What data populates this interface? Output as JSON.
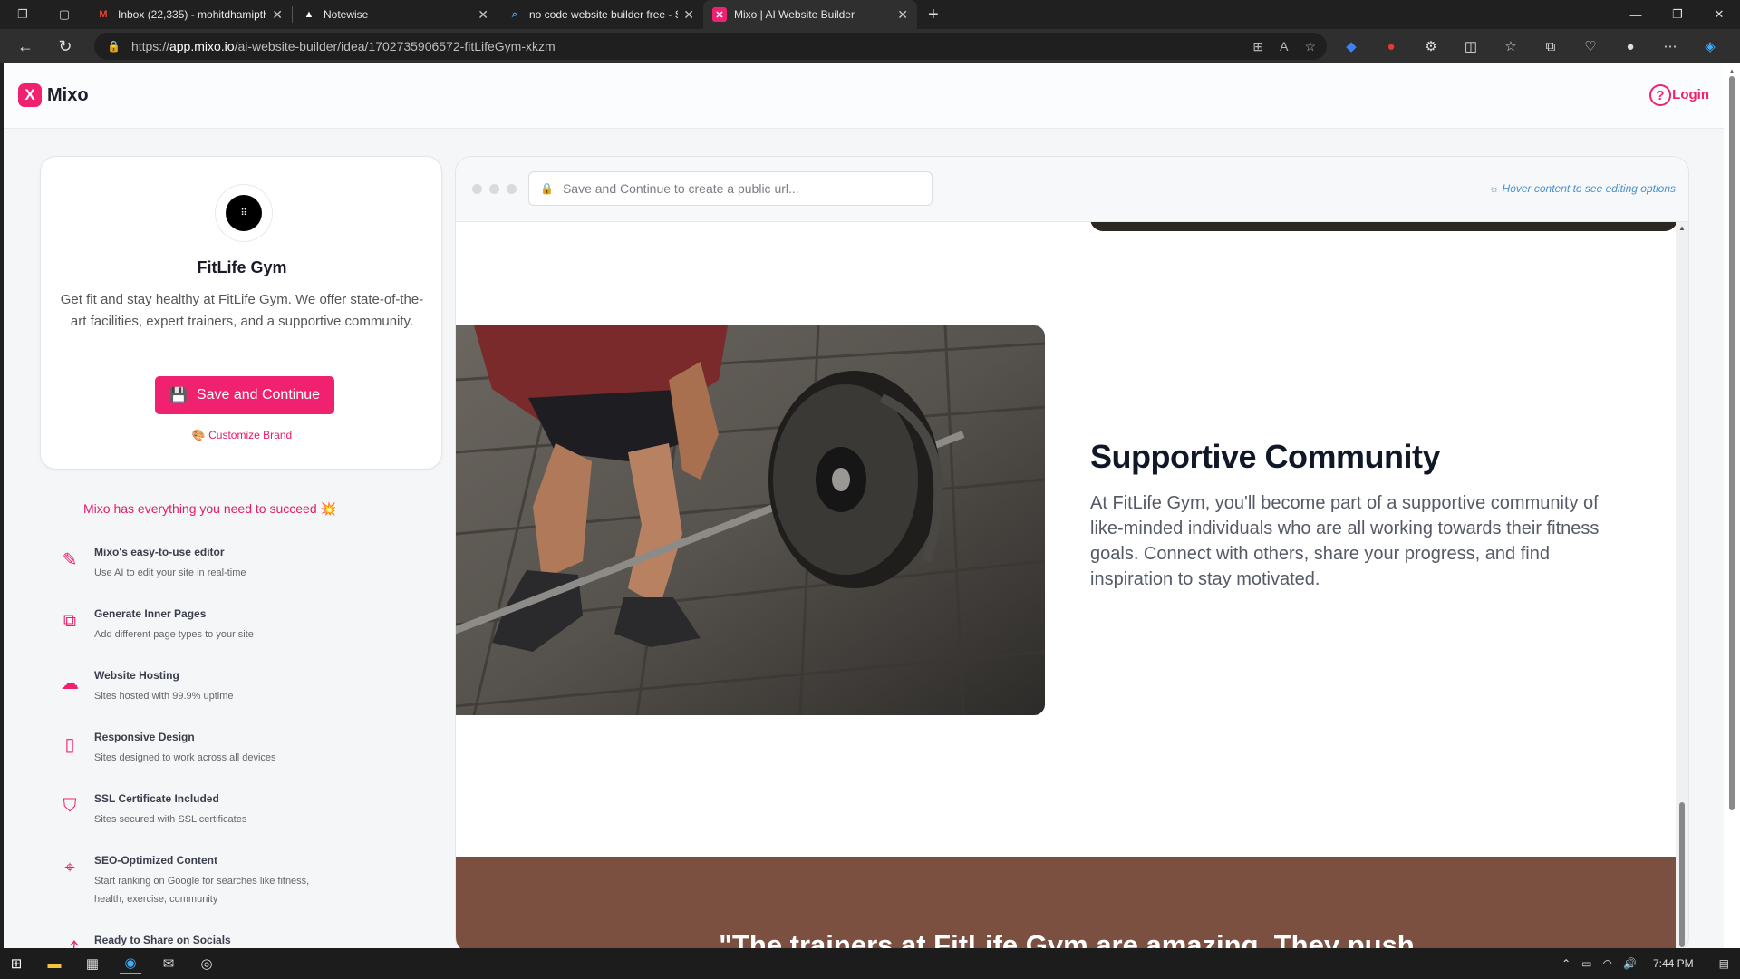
{
  "browser": {
    "tabs": [
      {
        "title": "Inbox (22,335) - mohitdhamipth",
        "icon": "gmail-icon",
        "active": false
      },
      {
        "title": "Notewise",
        "icon": "notewise-icon",
        "active": false
      },
      {
        "title": "no code website builder free - Se",
        "icon": "search-icon",
        "active": false
      },
      {
        "title": "Mixo | AI Website Builder",
        "icon": "mixo-icon",
        "active": true
      }
    ],
    "url_scheme": "https://",
    "url_host": "app.mixo.io",
    "url_path": "/ai-website-builder/idea/1702735906572-fitLifeGym-xkzm"
  },
  "app": {
    "logo_text": "Mixo",
    "logo_mark": "X",
    "login_label": "Login",
    "help_glyph": "?"
  },
  "card": {
    "avatar_glyph": "⠿",
    "business_name": "FitLife Gym",
    "description": "Get fit and stay healthy at FitLife Gym. We offer state-of-the-art facilities, expert trainers, and a supportive community.",
    "save_label": "Save and Continue",
    "customize_label": "Customize Brand"
  },
  "sidebar": {
    "succeed_text": "Mixo has everything you need to succeed 💥",
    "features": [
      {
        "title": "Mixo's easy-to-use editor",
        "desc": "Use AI to edit your site in real-time",
        "icon": "pencil-icon",
        "glyph": "✎"
      },
      {
        "title": "Generate Inner Pages",
        "desc": "Add different page types to your site",
        "icon": "copy-pages-icon",
        "glyph": "⧉"
      },
      {
        "title": "Website Hosting",
        "desc": "Sites hosted with 99.9% uptime",
        "icon": "cloud-globe-icon",
        "glyph": "☁"
      },
      {
        "title": "Responsive Design",
        "desc": "Sites designed to work across all devices",
        "icon": "devices-icon",
        "glyph": "▯"
      },
      {
        "title": "SSL Certificate Included",
        "desc": "Sites secured with SSL certificates",
        "icon": "shield-check-icon",
        "glyph": "⛉"
      },
      {
        "title": "SEO-Optimized Content",
        "desc": "Start ranking on Google for searches like fitness, health, exercise, community",
        "icon": "cursor-click-icon",
        "glyph": "⌖"
      },
      {
        "title": "Ready to Share on Socials",
        "desc": "",
        "icon": "share-icon",
        "glyph": "⤴"
      }
    ]
  },
  "preview": {
    "url_placeholder": "Save and Continue to create a public url...",
    "hover_hint": "Hover content to see editing options",
    "section_heading": "Supportive Community",
    "section_text": "At FitLife Gym, you'll become part of a supportive community of like-minded individuals who are all working towards their fitness goals. Connect with others, share your progress, and find inspiration to stay motivated.",
    "quote_text": "\"The trainers at FitLife Gym are amazing. They push"
  },
  "taskbar": {
    "time": "7:44 PM"
  },
  "colors": {
    "accent": "#f0226f",
    "testimonial_bg": "#7c5040"
  }
}
